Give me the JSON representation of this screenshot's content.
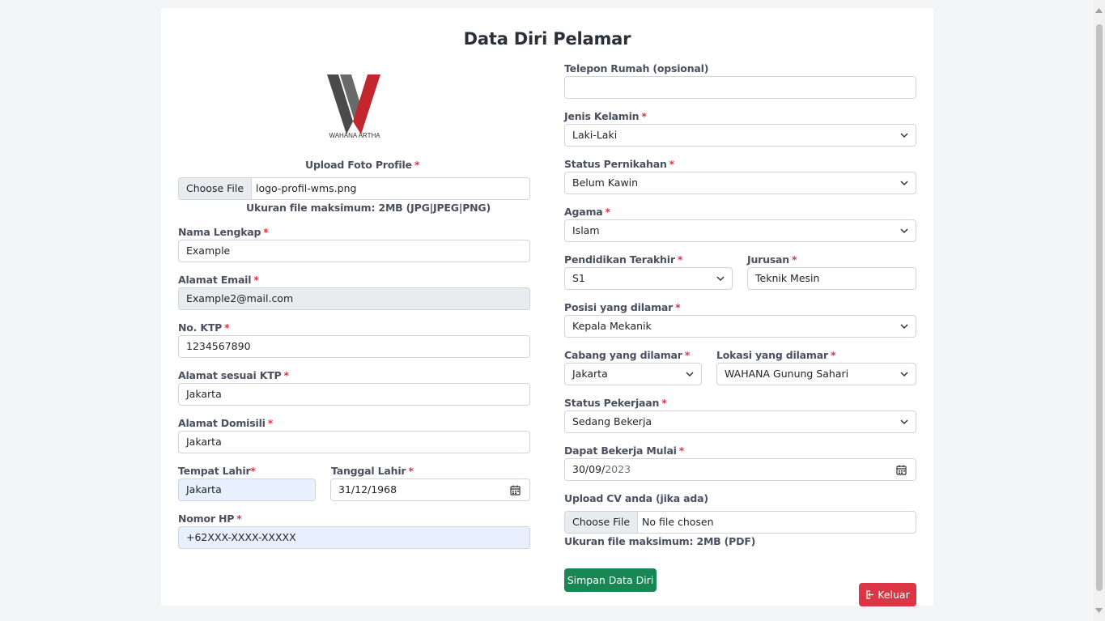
{
  "page": {
    "title": "Data Diri Pelamar"
  },
  "logo": {
    "text": "WAHANA ARTHA",
    "colors": {
      "dark": "#4a4a4a",
      "red": "#c1272d"
    }
  },
  "upload_photo": {
    "label": "Upload Foto Profile",
    "button": "Choose File",
    "file_name": "logo-profil-wms.png",
    "hint": "Ukuran file maksimum: 2MB (JPG|JPEG|PNG)"
  },
  "left": {
    "nama_lengkap": {
      "label": "Nama Lengkap",
      "value": "Example"
    },
    "alamat_email": {
      "label": "Alamat Email",
      "value": "Example2@mail.com"
    },
    "no_ktp": {
      "label": "No. KTP",
      "value": "1234567890"
    },
    "alamat_ktp": {
      "label": "Alamat sesuai KTP",
      "value": "Jakarta"
    },
    "alamat_domisili": {
      "label": "Alamat Domisili",
      "value": "Jakarta"
    },
    "tempat_lahir": {
      "label": "Tempat Lahir",
      "value": "Jakarta"
    },
    "tanggal_lahir": {
      "label": "Tanggal Lahir",
      "value": "31/12/1968"
    },
    "nomor_hp": {
      "label": "Nomor HP",
      "value": "+62XXX-XXXX-XXXXX"
    }
  },
  "right": {
    "telepon_rumah": {
      "label": "Telepon Rumah (opsional)",
      "value": ""
    },
    "jenis_kelamin": {
      "label": "Jenis Kelamin",
      "value": "Laki-Laki"
    },
    "status_pernikahan": {
      "label": "Status Pernikahan",
      "value": "Belum Kawin"
    },
    "agama": {
      "label": "Agama",
      "value": "Islam"
    },
    "pendidikan": {
      "label": "Pendidikan Terakhir",
      "value": "S1"
    },
    "jurusan": {
      "label": "Jurusan",
      "value": "Teknik Mesin"
    },
    "posisi": {
      "label": "Posisi yang dilamar",
      "value": "Kepala Mekanik"
    },
    "cabang": {
      "label": "Cabang yang dilamar",
      "value": "Jakarta"
    },
    "lokasi": {
      "label": "Lokasi yang dilamar",
      "value": "WAHANA Gunung Sahari"
    },
    "status_pekerjaan": {
      "label": "Status Pekerjaan",
      "value": "Sedang Bekerja"
    },
    "mulai_bekerja": {
      "label": "Dapat Bekerja Mulai",
      "value_day_month": "30/09/",
      "value_year": "2023"
    },
    "upload_cv": {
      "label": "Upload CV anda (jika ada)",
      "button": "Choose File",
      "file_name": "No file chosen",
      "hint": "Ukuran file maksimum: 2MB (PDF)"
    }
  },
  "required_mark": "*",
  "buttons": {
    "save": "Simpan Data Diri",
    "logout": "Keluar"
  },
  "colors": {
    "save": "#198754",
    "logout": "#dc3545",
    "required": "#dc3545"
  }
}
